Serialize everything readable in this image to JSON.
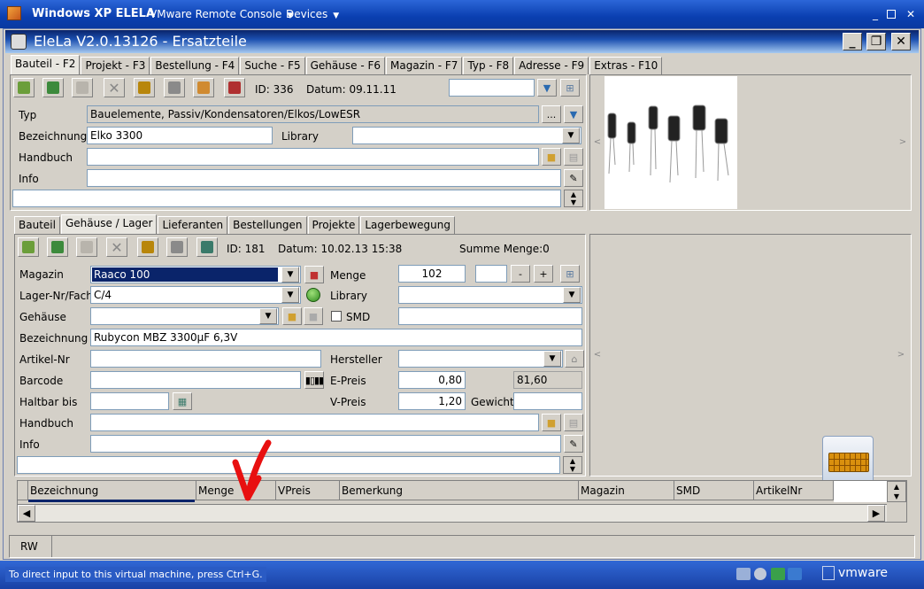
{
  "vm": {
    "title": "Windows XP ELELA",
    "menu_console": "VMware Remote Console",
    "menu_devices": "Devices",
    "hint": "To direct input to this virtual machine, press Ctrl+G.",
    "brand": "vmware"
  },
  "app": {
    "title": "EleLa V2.0.13126  - Ersatzteile"
  },
  "main_tabs": [
    "Bauteil - F2",
    "Projekt - F3",
    "Bestellung - F4",
    "Suche - F5",
    "Gehäuse - F6",
    "Magazin - F7",
    "Typ - F8",
    "Adresse - F9",
    "Extras - F10"
  ],
  "part": {
    "id_text": "ID: 336",
    "date_text": "Datum: 09.11.11",
    "typ_label": "Typ",
    "typ_value": "Bauelemente, Passiv/Kondensatoren/Elkos/LowESR",
    "bez_label": "Bezeichnung",
    "bez_value": "Elko 3300",
    "library_label": "Library",
    "library_value": "",
    "handbuch_label": "Handbuch",
    "info_label": "Info",
    "more_btn": "..."
  },
  "sub_tabs": [
    "Bauteil",
    "Gehäuse / Lager",
    "Lieferanten",
    "Bestellungen",
    "Projekte",
    "Lagerbewegung"
  ],
  "stock": {
    "id_text": "ID: 181",
    "date_text": "Datum: 10.02.13 15:38",
    "sum_text": "Summe Menge:0",
    "magazin_label": "Magazin",
    "magazin_value": "Raaco 100",
    "menge_label": "Menge",
    "menge_value": "102",
    "minus": "-",
    "plus": "+",
    "lager_label": "Lager-Nr/Fach",
    "lager_value": "C/4",
    "library_label": "Library",
    "gehaeuse_label": "Gehäuse",
    "smd_label": "SMD",
    "bez_label": "Bezeichnung",
    "bez_value": "Rubycon MBZ 3300µF 6,3V",
    "artikel_label": "Artikel-Nr",
    "hersteller_label": "Hersteller",
    "barcode_label": "Barcode",
    "epreis_label": "E-Preis",
    "epreis_value": "0,80",
    "total_value": "81,60",
    "haltbar_label": "Haltbar bis",
    "vpreis_label": "V-Preis",
    "vpreis_value": "1,20",
    "gewicht_label": "Gewicht",
    "handbuch_label": "Handbuch",
    "info_label": "Info"
  },
  "grid": {
    "columns": [
      "Bezeichnung",
      "Menge",
      "VPreis",
      "Bemerkung",
      "Magazin",
      "SMD",
      "ArtikelNr"
    ]
  },
  "status": {
    "mode": "RW"
  },
  "colors": {
    "xp_blue": "#0a3fb0",
    "selection": "#0a246a",
    "annotation_red": "#e81010"
  }
}
